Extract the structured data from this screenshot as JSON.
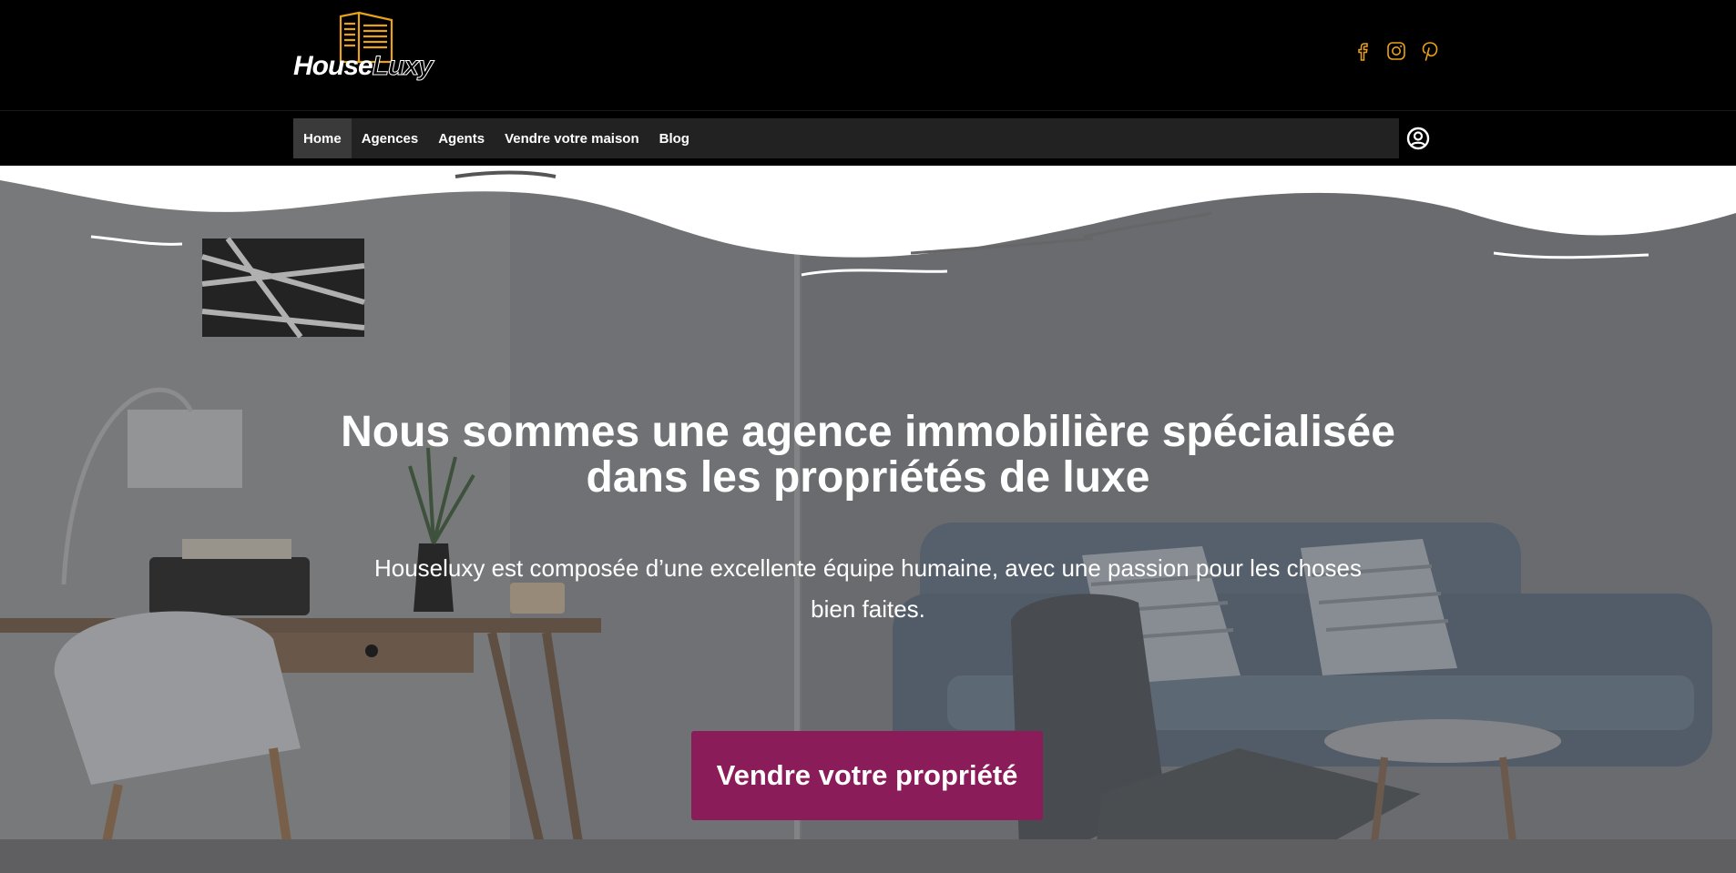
{
  "brand": {
    "word1": "House",
    "word2": "Luxy",
    "accent_color": "#e8a21a"
  },
  "socials": [
    {
      "name": "facebook-icon"
    },
    {
      "name": "instagram-icon"
    },
    {
      "name": "pinterest-icon"
    }
  ],
  "nav": {
    "items": [
      {
        "label": "Home",
        "active": true
      },
      {
        "label": "Agences"
      },
      {
        "label": "Agents"
      },
      {
        "label": "Vendre votre maison"
      },
      {
        "label": "Blog"
      }
    ],
    "user_icon": "user-circle-icon"
  },
  "hero": {
    "title": "Nous sommes une agence immobilière spécialisée dans les propriétés de luxe",
    "subtitle": "Houseluxy est composée d’une excellente équipe humaine, avec une passion pour les choses bien faites.",
    "cta_label": "Vendre votre propriété",
    "cta_color": "#8a1c5a"
  }
}
